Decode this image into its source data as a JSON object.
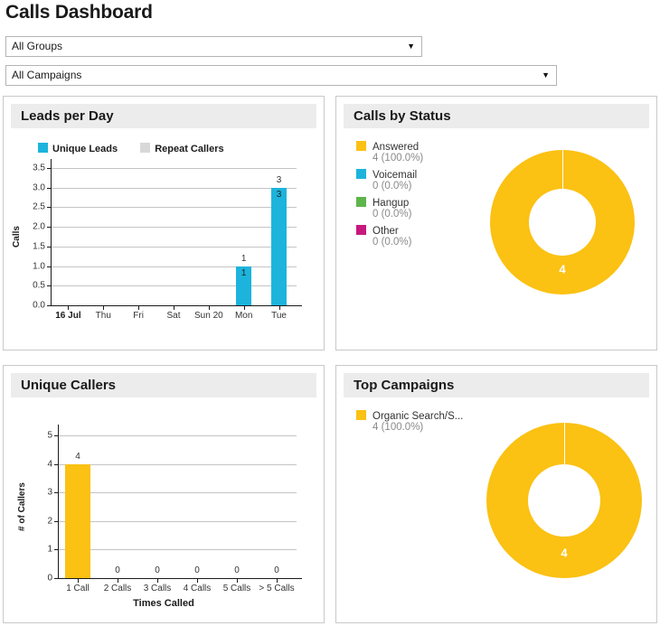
{
  "header": {
    "title": "Calls Dashboard",
    "filters": [
      {
        "name": "groups",
        "value": "All Groups",
        "caret": "▼"
      },
      {
        "name": "campaigns",
        "value": "All Campaigns",
        "caret": "▼"
      }
    ]
  },
  "colors": {
    "amber": "#FBC113",
    "cyan": "#1CB4DC",
    "green": "#5EB54B",
    "magenta": "#C7187E",
    "gray": "#D8D8D8",
    "panel_header_bg": "#ECECEC",
    "panel_border": "#C9C9C9",
    "gridline": "#C4C4C4"
  },
  "panels": {
    "leads": {
      "title": "Leads per Day"
    },
    "status": {
      "title": "Calls by Status"
    },
    "callers": {
      "title": "Unique Callers"
    },
    "campaigns": {
      "title": "Top Campaigns"
    }
  },
  "chart_data": [
    {
      "id": "leads_per_day",
      "type": "bar",
      "title": "Leads per Day",
      "xlabel": "",
      "ylabel": "Calls",
      "ylim": [
        0,
        3.5
      ],
      "yticks": [
        "0.0",
        "0.5",
        "1.0",
        "1.5",
        "2.0",
        "2.5",
        "3.0",
        "3.5"
      ],
      "ytick_values": [
        0,
        0.5,
        1,
        1.5,
        2,
        2.5,
        3,
        3.5
      ],
      "grid": true,
      "legend_position": "top-left",
      "categories": [
        "16 Jul",
        "Thu",
        "Fri",
        "Sat",
        "Sun 20",
        "Mon",
        "Tue"
      ],
      "category_bold": [
        true,
        false,
        false,
        false,
        false,
        false,
        false
      ],
      "series": [
        {
          "name": "Unique Leads",
          "color": "#1CB4DC",
          "values": [
            0,
            0,
            0,
            0,
            0,
            1,
            3
          ]
        },
        {
          "name": "Repeat Callers",
          "color": "#D8D8D8",
          "values": [
            0,
            0,
            0,
            0,
            0,
            0,
            0
          ]
        }
      ],
      "bar_labels": [
        {
          "category": "Mon",
          "above": "1",
          "inside": "1"
        },
        {
          "category": "Tue",
          "above": "3",
          "inside": "3"
        }
      ]
    },
    {
      "id": "calls_by_status",
      "type": "pie",
      "title": "Calls by Status",
      "donut": true,
      "center_label": "",
      "slice_label": "4",
      "legend_position": "left",
      "slices": [
        {
          "label": "Answered",
          "value": "4",
          "percent": "(100.0%)",
          "color": "#FBC113"
        },
        {
          "label": "Voicemail",
          "value": "0",
          "percent": "(0.0%)",
          "color": "#1CB4DC"
        },
        {
          "label": "Hangup",
          "value": "0",
          "percent": "(0.0%)",
          "color": "#5EB54B"
        },
        {
          "label": "Other",
          "value": "0",
          "percent": "(0.0%)",
          "color": "#C7187E"
        }
      ]
    },
    {
      "id": "unique_callers",
      "type": "bar",
      "title": "Unique Callers",
      "xlabel": "Times Called",
      "ylabel": "# of Callers",
      "ylim": [
        0,
        5
      ],
      "yticks": [
        "0",
        "1",
        "2",
        "3",
        "4",
        "5"
      ],
      "ytick_values": [
        0,
        1,
        2,
        3,
        4,
        5
      ],
      "grid": true,
      "categories": [
        "1 Call",
        "2 Calls",
        "3 Calls",
        "4 Calls",
        "5 Calls",
        "> 5 Calls"
      ],
      "values": [
        4,
        0,
        0,
        0,
        0,
        0
      ],
      "value_labels": [
        "4",
        "0",
        "0",
        "0",
        "0",
        "0"
      ],
      "bar_color": "#FBC113"
    },
    {
      "id": "top_campaigns",
      "type": "pie",
      "title": "Top Campaigns",
      "donut": true,
      "slice_label": "4",
      "legend_position": "left",
      "slices": [
        {
          "label": "Organic Search/S...",
          "value": "4",
          "percent": "(100.0%)",
          "color": "#FBC113"
        }
      ]
    }
  ]
}
